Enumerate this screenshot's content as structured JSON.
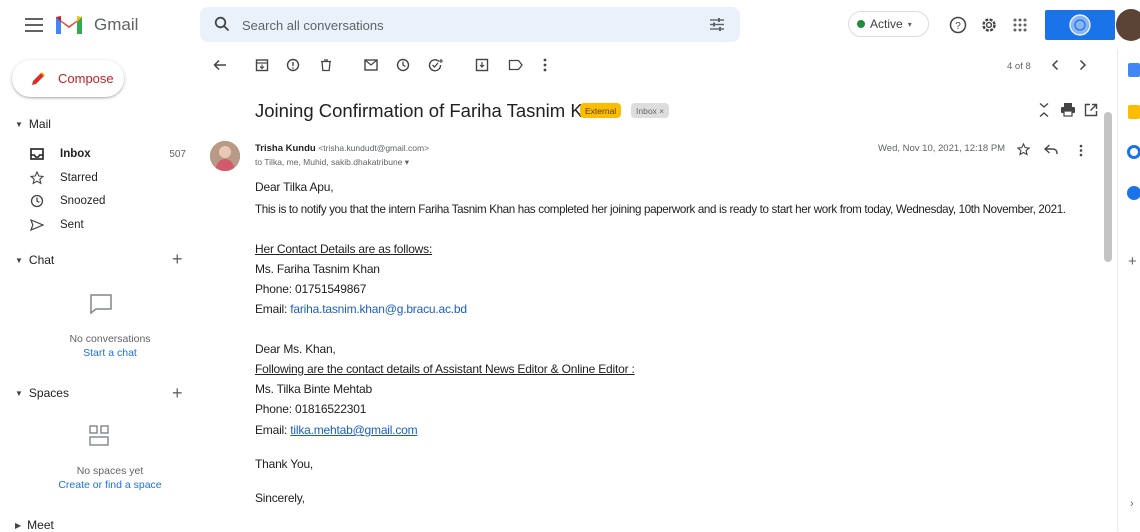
{
  "app": {
    "name": "Gmail"
  },
  "search": {
    "placeholder": "Search all conversations"
  },
  "status": {
    "label": "Active"
  },
  "sidebar": {
    "compose": "Compose",
    "mail_section": "Mail",
    "items": [
      {
        "label": "Inbox",
        "count": "507"
      },
      {
        "label": "Starred"
      },
      {
        "label": "Snoozed"
      },
      {
        "label": "Sent"
      }
    ],
    "chat_section": "Chat",
    "chat_empty": "No conversations",
    "chat_link": "Start a chat",
    "spaces_section": "Spaces",
    "spaces_empty": "No spaces yet",
    "spaces_link": "Create or find a space",
    "meet_section": "Meet"
  },
  "toolbar": {
    "pager": "4 of 8"
  },
  "message": {
    "subject": "Joining Confirmation of Fariha Tasnim Khan",
    "labels": {
      "external": "External",
      "inbox": "Inbox ×"
    },
    "sender_name": "Trisha Kundu",
    "sender_email": "<trisha.kundudt@gmail.com>",
    "to": "to Tilka, me, Muhid, sakib.dhakatribune ▾",
    "date": "Wed, Nov 10, 2021, 12:18 PM",
    "body": {
      "greeting": "Dear Tilka Apu,",
      "p1": "This is to notify you that the intern Fariha Tasnim Khan  has completed her joining paperwork and is ready to start her work from today, Wednesday, 10th November, 2021.",
      "contact_heading": "Her Contact Details are as follows:",
      "name1": "Ms. Fariha Tasnim Khan",
      "phone1": "Phone: 01751549867",
      "email1_label": "Email: ",
      "email1": "fariha.tasnim.khan@g.bracu.ac.bd",
      "greeting2": "Dear Ms. Khan,",
      "contact_heading2": "Following are the contact details of Assistant News Editor & Online Editor :",
      "name2": "Ms. Tilka Binte Mehtab",
      "phone2": "Phone: 01816522301",
      "email2_label": "Email: ",
      "email2": "tilka.mehtab@gmail.com",
      "thanks": "Thank You,",
      "signoff": "Sincerely,"
    }
  },
  "colors": {
    "accent": "#1a73e8",
    "compose_red": "#c5221f",
    "external_badge": "#fbbc04",
    "active_green": "#1e8e3e"
  },
  "icons": [
    "menu-icon",
    "gmail-logo",
    "search-icon",
    "filter-icon",
    "help-icon",
    "settings-icon",
    "apps-icon"
  ]
}
